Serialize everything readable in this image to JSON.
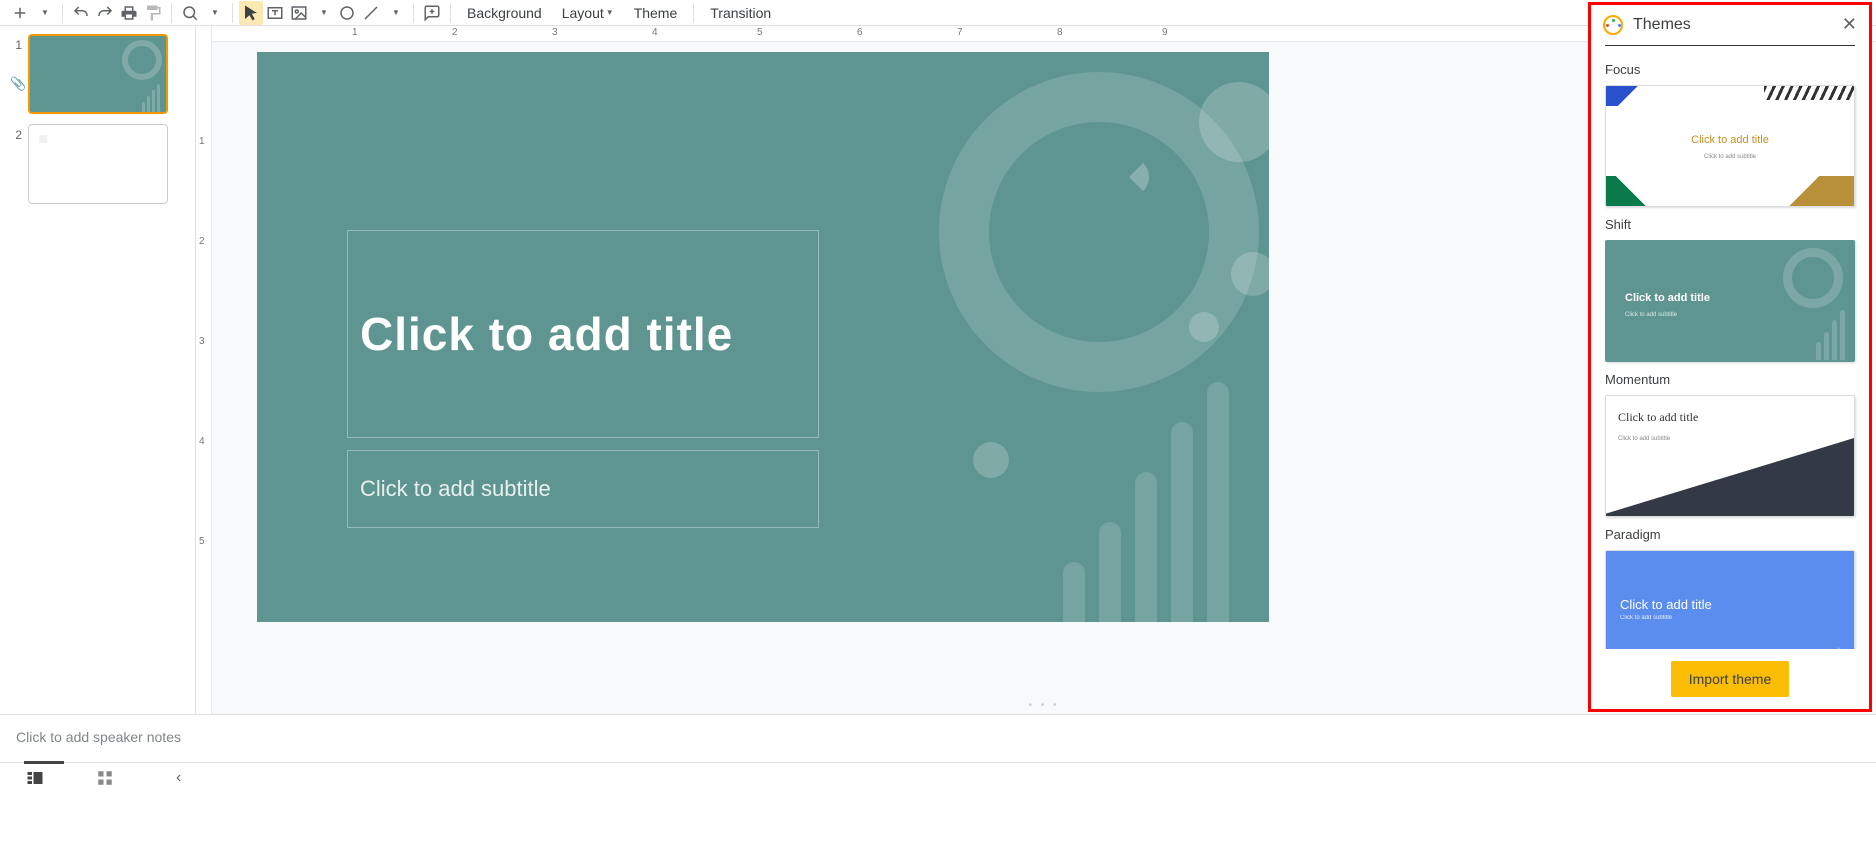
{
  "toolbar": {
    "background": "Background",
    "layout": "Layout",
    "theme": "Theme",
    "transition": "Transition"
  },
  "ruler": {
    "h": [
      "1",
      "2",
      "3",
      "4",
      "5",
      "6",
      "7",
      "8",
      "9"
    ],
    "v": [
      "1",
      "2",
      "3",
      "4",
      "5"
    ]
  },
  "filmstrip": {
    "slides": [
      {
        "num": "1",
        "selected": true,
        "kind": "shift"
      },
      {
        "num": "2",
        "selected": false,
        "kind": "blank"
      }
    ]
  },
  "slide": {
    "title_placeholder": "Click to add title",
    "subtitle_placeholder": "Click to add subtitle"
  },
  "notes": {
    "placeholder": "Click to add speaker notes"
  },
  "panel": {
    "title": "Themes",
    "import": "Import theme",
    "themes": [
      {
        "name": "Focus",
        "prev_title": "Click to add title",
        "prev_sub": "Click to add subtitle"
      },
      {
        "name": "Shift",
        "prev_title": "Click to add title",
        "prev_sub": "Click to add subtitle",
        "selected": true
      },
      {
        "name": "Momentum",
        "prev_title": "Click to add title",
        "prev_sub": "Click to add subtitle"
      },
      {
        "name": "Paradigm",
        "prev_title": "Click to add title",
        "prev_sub": "Click to add subtitle"
      }
    ]
  }
}
